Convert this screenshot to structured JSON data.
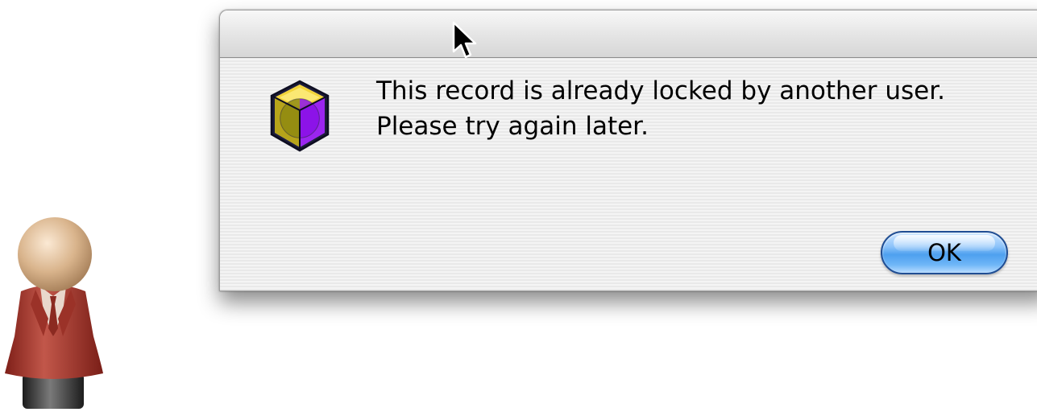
{
  "alert": {
    "message_line1": "This record is already locked by another user.",
    "message_line2": "Please try again later.",
    "ok_label": "OK",
    "icon": "application-cube-icon"
  },
  "cursor": {
    "icon": "arrow-cursor-icon"
  },
  "user": {
    "icon": "user-figure-icon"
  },
  "colors": {
    "button_accent": "#4ea0ef",
    "user_jacket": "#a33a2e",
    "user_head": "#d9b48c"
  }
}
